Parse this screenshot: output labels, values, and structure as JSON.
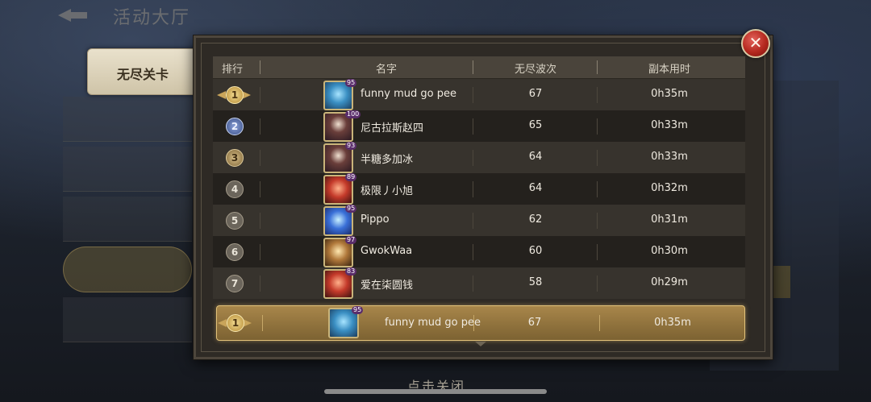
{
  "background": {
    "title": "活动大厅"
  },
  "side_tab": {
    "label": "无尽关卡"
  },
  "table": {
    "headers": {
      "rank": "排行",
      "name": "名字",
      "waves": "无尽波次",
      "time": "副本用时"
    },
    "rows": [
      {
        "rank": "1",
        "badge": "gold",
        "avatar": "av-blue",
        "level": "95",
        "name": "funny mud go pee",
        "waves": "67",
        "time": "0h35m"
      },
      {
        "rank": "2",
        "badge": "silver",
        "avatar": "av-dark",
        "level": "100",
        "name": "尼古拉斯赵四",
        "waves": "65",
        "time": "0h33m"
      },
      {
        "rank": "3",
        "badge": "bronze",
        "avatar": "av-dark",
        "level": "93",
        "name": "半糖多加冰",
        "waves": "64",
        "time": "0h33m"
      },
      {
        "rank": "4",
        "badge": "plain",
        "avatar": "av-red",
        "level": "89",
        "name": "极限丿小旭",
        "waves": "64",
        "time": "0h32m"
      },
      {
        "rank": "5",
        "badge": "plain",
        "avatar": "av-cyan",
        "level": "95",
        "name": "Pippo",
        "waves": "62",
        "time": "0h31m"
      },
      {
        "rank": "6",
        "badge": "plain",
        "avatar": "av-gold",
        "level": "97",
        "name": "GwokWaa",
        "waves": "60",
        "time": "0h30m"
      },
      {
        "rank": "7",
        "badge": "plain",
        "avatar": "av-red",
        "level": "83",
        "name": "爱在柒圆钱",
        "waves": "58",
        "time": "0h29m"
      }
    ],
    "self": {
      "rank": "1",
      "level": "95",
      "name": "funny mud go pee",
      "waves": "67",
      "time": "0h35m"
    }
  },
  "close_hint": "点击关闭",
  "icons": {
    "close": "close-x-icon",
    "rank_badge": "rank-badge-icon",
    "avatar": "player-avatar-icon"
  }
}
